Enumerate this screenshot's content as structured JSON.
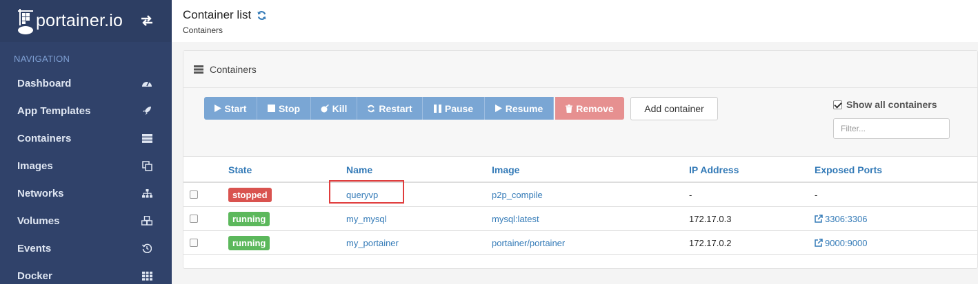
{
  "brand": {
    "name": "portainer.io"
  },
  "nav": {
    "title": "NAVIGATION",
    "items": [
      {
        "label": "Dashboard",
        "icon": "dashboard-icon"
      },
      {
        "label": "App Templates",
        "icon": "rocket-icon"
      },
      {
        "label": "Containers",
        "icon": "server-icon"
      },
      {
        "label": "Images",
        "icon": "clone-icon"
      },
      {
        "label": "Networks",
        "icon": "sitemap-icon"
      },
      {
        "label": "Volumes",
        "icon": "cubes-icon"
      },
      {
        "label": "Events",
        "icon": "history-icon"
      },
      {
        "label": "Docker",
        "icon": "th-icon"
      }
    ]
  },
  "header": {
    "title": "Container list",
    "subtitle": "Containers"
  },
  "widget": {
    "title": "Containers"
  },
  "toolbar": {
    "buttons": [
      {
        "label": "Start",
        "icon": "play-icon"
      },
      {
        "label": "Stop",
        "icon": "stop-icon"
      },
      {
        "label": "Kill",
        "icon": "bomb-icon"
      },
      {
        "label": "Restart",
        "icon": "refresh-icon"
      },
      {
        "label": "Pause",
        "icon": "pause-icon"
      },
      {
        "label": "Resume",
        "icon": "play-icon"
      },
      {
        "label": "Remove",
        "icon": "trash-icon"
      }
    ],
    "add_label": "Add container",
    "show_all_label": "Show all containers",
    "show_all_checked": true,
    "filter_placeholder": "Filter..."
  },
  "table": {
    "headers": [
      "State",
      "Name",
      "Image",
      "IP Address",
      "Exposed Ports"
    ],
    "rows": [
      {
        "state": "stopped",
        "name": "queryvp",
        "image": "p2p_compile",
        "ip": "-",
        "ports": "-"
      },
      {
        "state": "running",
        "name": "my_mysql",
        "image": "mysql:latest",
        "ip": "172.17.0.3",
        "ports": "3306:3306"
      },
      {
        "state": "running",
        "name": "my_portainer",
        "image": "portainer/portainer",
        "ip": "172.17.0.2",
        "ports": "9000:9000"
      }
    ]
  },
  "colors": {
    "sidebar": "#30426a",
    "primary": "#7aa6d4",
    "danger": "#e69090",
    "link": "#337ab7",
    "stopped": "#d9534f",
    "running": "#5cb85c",
    "highlight": "#e03c3c"
  }
}
